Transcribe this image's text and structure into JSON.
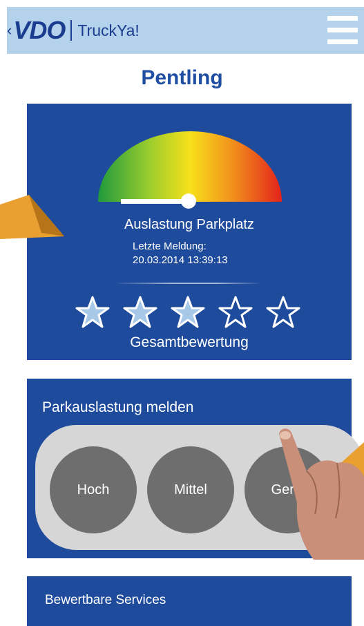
{
  "header": {
    "brand_logo": "VDO",
    "brand_name": "TruckYa!",
    "back_icon": "chevron-left-icon",
    "menu_icon": "hamburger-menu-icon"
  },
  "page_title": "Pentling",
  "parking_status": {
    "gauge_label": "Auslastung Parkplatz",
    "last_report_caption": "Letzte Meldung:",
    "last_report_time": "20.03.2014 13:39:13",
    "occupancy_level": 0.5
  },
  "rating": {
    "stars_filled": 3,
    "stars_total": 5,
    "label": "Gesamtbewertung"
  },
  "report": {
    "label": "Parkauslastung melden",
    "options": [
      "Hoch",
      "Mittel",
      "Gerin"
    ]
  },
  "services": {
    "label": "Bewertbare Services"
  },
  "colors": {
    "header_bg": "#b4d2ec",
    "brand_blue": "#1b3d8f",
    "card_bg": "#1f4b9c",
    "title": "#1f4ea3",
    "pill_bg": "#d6d6d6",
    "circle_bg": "#6e6e6e",
    "star_fill": "#a8c8e8",
    "callout_arrow": "#e9a030"
  }
}
